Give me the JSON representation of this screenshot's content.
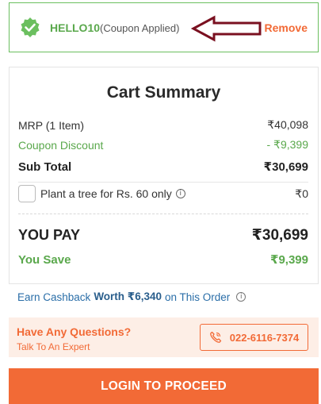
{
  "coupon": {
    "code": "HELLO10",
    "status": "(Coupon Applied)",
    "remove_label": "Remove",
    "icon": "check-badge-icon",
    "accent_color": "#5aa84c"
  },
  "summary": {
    "title": "Cart Summary",
    "mrp_label": "MRP (1 Item)",
    "mrp_value": "₹40,098",
    "coupon_label": "Coupon Discount",
    "coupon_value": "- ₹9,399",
    "subtotal_label": "Sub Total",
    "subtotal_value": "₹30,699",
    "tree_label": "Plant a tree for Rs. 60 only",
    "tree_value": "₹0",
    "tree_checked": false,
    "pay_label": "YOU PAY",
    "pay_value": "₹30,699",
    "save_label": "You Save",
    "save_value": "₹9,399"
  },
  "cashback": {
    "prefix": "Earn Cashback",
    "amount": "Worth ₹6,340",
    "suffix": "on This Order"
  },
  "help": {
    "title": "Have Any Questions?",
    "subtitle": "Talk To An Expert",
    "phone": "022-6116-7374"
  },
  "cta": {
    "label": "LOGIN TO PROCEED",
    "color": "#f26a36"
  }
}
